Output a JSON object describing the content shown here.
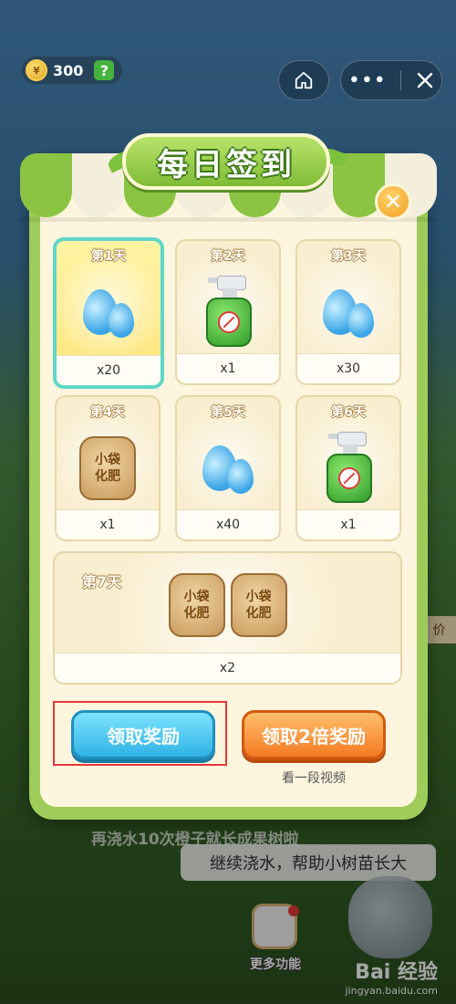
{
  "top_bar": {
    "coins": "300",
    "help_label": "?",
    "home_icon": "home-icon",
    "more_icon": "more-icon",
    "close_icon": "close-icon"
  },
  "modal": {
    "title": "每日签到",
    "close_label": "✕",
    "days": [
      {
        "label": "第1天",
        "item": "water-drop",
        "qty": "x20",
        "today": true
      },
      {
        "label": "第2天",
        "item": "spray-bottle",
        "qty": "x1"
      },
      {
        "label": "第3天",
        "item": "water-drop",
        "qty": "x30"
      },
      {
        "label": "第4天",
        "item": "fertilizer-bag",
        "bag_text_1": "小袋",
        "bag_text_2": "化肥",
        "qty": "x1"
      },
      {
        "label": "第5天",
        "item": "water-drop",
        "qty": "x40"
      },
      {
        "label": "第6天",
        "item": "spray-bottle",
        "qty": "x1"
      },
      {
        "label": "第7天",
        "item": "fertilizer-bag",
        "bag_text_1": "小袋",
        "bag_text_2": "化肥",
        "qty": "x2"
      }
    ],
    "claim_label": "领取奖励",
    "claim_double_label": "领取2倍奖励",
    "video_hint": "看一段视频"
  },
  "background": {
    "caption": "再浇水10次橙子就长成果树啦",
    "tip": "继续浇水，帮助小树苗长大",
    "more_label": "更多功能",
    "side_tag": "价",
    "watermark_brand": "Bai 经验",
    "watermark_url": "jingyan.baidu.com"
  },
  "colors": {
    "frame_green": "#9dcc5a",
    "claim_blue": "#2fb3e6",
    "claim_orange": "#f57a23",
    "highlight_red": "#e53935"
  }
}
